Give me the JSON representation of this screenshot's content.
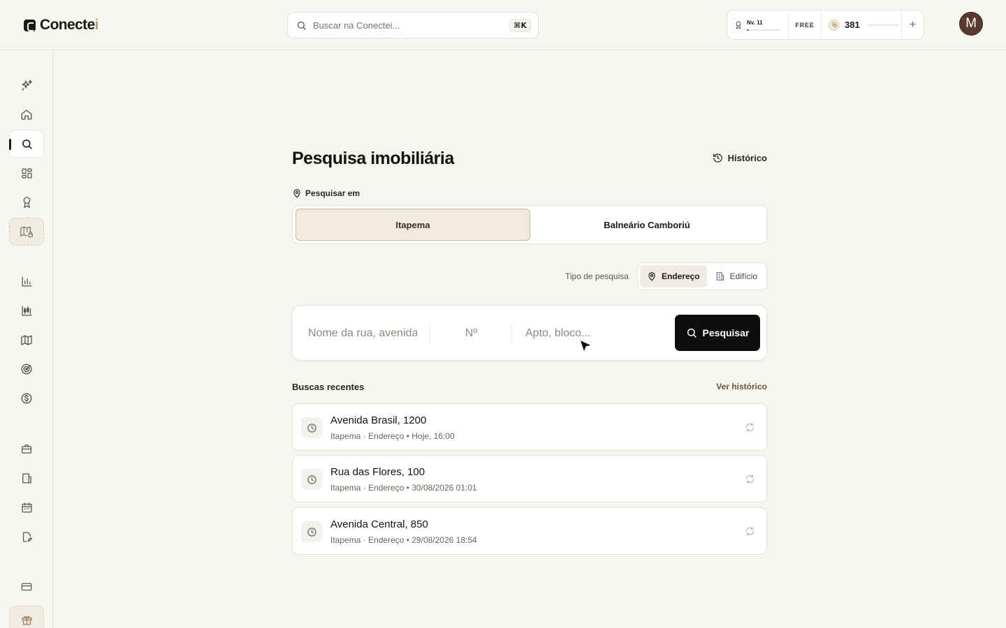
{
  "brand": {
    "name_main": "Conecte",
    "name_accent": "i"
  },
  "topbar": {
    "search_placeholder": "Buscar na Conectei...",
    "search_shortcut": "⌘K",
    "level": "Nv. 11",
    "level_progress": 0.06,
    "plan": "FREE",
    "credits": "381",
    "add_label": "+",
    "avatar_initial": "M"
  },
  "sidebar": {
    "items": [
      {
        "name": "sparkles-icon"
      },
      {
        "name": "home-icon"
      },
      {
        "name": "search-icon",
        "active": true
      },
      {
        "name": "grid-icon"
      },
      {
        "name": "award-icon"
      },
      {
        "name": "map-lock-icon"
      },
      {
        "name": "bar-chart-icon"
      },
      {
        "name": "candlestick-icon"
      },
      {
        "name": "map-icon"
      },
      {
        "name": "radar-icon"
      },
      {
        "name": "dollar-icon"
      },
      {
        "name": "briefcase-icon"
      },
      {
        "name": "building-icon"
      },
      {
        "name": "calendar-icon"
      },
      {
        "name": "edit-document-icon"
      },
      {
        "name": "credit-card-icon"
      },
      {
        "name": "gift-icon"
      }
    ]
  },
  "main": {
    "title": "Pesquisa imobiliária",
    "history_label": "Histórico",
    "search_in_label": "Pesquisar em",
    "cities": [
      "Itapema",
      "Balneário Camboriú"
    ],
    "selected_city": "Itapema",
    "search_type_label": "Tipo de pesquisa",
    "search_types": [
      "Endereço",
      "Edifício"
    ],
    "selected_type": "Endereço",
    "address": {
      "street_placeholder": "Nome da rua, avenida...",
      "number_placeholder": "Nº",
      "unit_placeholder": "Apto, bloco..."
    },
    "search_button": "Pesquisar",
    "recent_title": "Buscas recentes",
    "recent_link": "Ver histórico",
    "recent": [
      {
        "title": "Avenida Brasil, 1200",
        "meta": "Itapema · Endereço • Hoje, 16:00"
      },
      {
        "title": "Rua das Flores, 100",
        "meta": "Itapema · Endereço • 30/08/2026 01:01"
      },
      {
        "title": "Avenida Central, 850",
        "meta": "Itapema · Endereço • 29/08/2026 18:54"
      }
    ]
  }
}
